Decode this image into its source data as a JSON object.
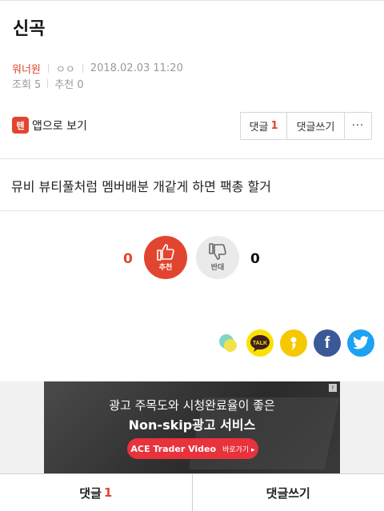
{
  "post": {
    "title": "신곡",
    "author": "워너원",
    "nickname": "ㅇㅇ",
    "datetime": "2018.02.03 11:20",
    "views": "조회 5",
    "recommends": "추천 0",
    "body": "뮤비 뷰티풀처럼 멤버배분 개같게 하면 팩총 할거"
  },
  "toolbar": {
    "app_icon_glyph": "텐",
    "app_link_label": "앱으로 보기",
    "comment_label": "댓글",
    "comment_count": "1",
    "write_label": "댓글쓰기",
    "more_label": "···"
  },
  "vote": {
    "up_count": "0",
    "up_label": "추천",
    "down_count": "0",
    "down_label": "반대",
    "accent": "#e2452f"
  },
  "share": {
    "icons": [
      "line-icon",
      "kakaotalk-icon",
      "kakaostory-icon",
      "facebook-icon",
      "twitter-icon"
    ],
    "talk_label": "TALK",
    "fb_glyph": "f"
  },
  "ad": {
    "line1": "광고 주목도와 시청완료율이 좋은",
    "line2": "Non-skip광고 서비스",
    "cta_brand": "ACE Trader Video",
    "cta_action": "바로가기 ▸",
    "badge": "!"
  },
  "bottom_bar": {
    "comment_label": "댓글",
    "comment_count": "1",
    "write_label": "댓글쓰기"
  }
}
